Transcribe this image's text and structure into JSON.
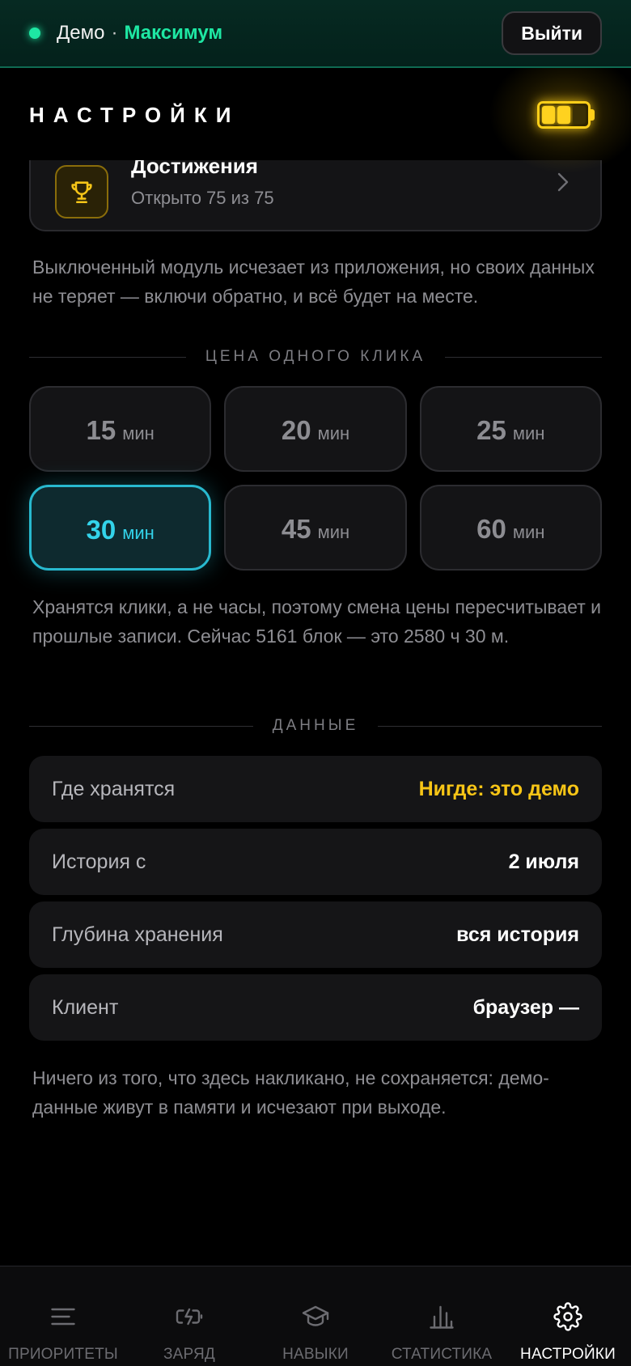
{
  "topbar": {
    "mode": "Демо",
    "separator": "·",
    "plan": "Максимум",
    "logout_label": "Выйти"
  },
  "header": {
    "title": "НАСТРОЙКИ",
    "battery": {
      "icon": "battery-icon",
      "cells_filled": 2,
      "cells_total": 3,
      "color": "#ffcf1a"
    }
  },
  "modules": {
    "achievements": {
      "icon": "trophy-icon",
      "title": "Достижения",
      "subtitle": "Открыто 75 из 75"
    },
    "note": "Выключенный модуль исчезает из приложения, но своих данных не теряет — включи обратно, и всё будет на месте."
  },
  "click_price": {
    "section_title": "ЦЕНА ОДНОГО КЛИКА",
    "unit": "мин",
    "options": [
      {
        "value": "15",
        "selected": false
      },
      {
        "value": "20",
        "selected": false
      },
      {
        "value": "25",
        "selected": false
      },
      {
        "value": "30",
        "selected": true
      },
      {
        "value": "45",
        "selected": false
      },
      {
        "value": "60",
        "selected": false
      }
    ],
    "note": "Хранятся клики, а не часы, поэтому смена цены пересчитывает и прошлые записи. Сейчас 5161 блок — это 2580 ч 30 м."
  },
  "data_section": {
    "section_title": "ДАННЫЕ",
    "rows": [
      {
        "key": "Где хранятся",
        "value": "Нигде: это демо"
      },
      {
        "key": "История с",
        "value": "2 июля"
      },
      {
        "key": "Глубина хранения",
        "value": "вся история"
      },
      {
        "key": "Клиент",
        "value": "браузер —"
      }
    ],
    "note": "Ничего из того, что здесь накликано, не сохраняется: демо-данные живут в памяти и исчезают при выходе."
  },
  "nav": {
    "items": [
      {
        "label": "ПРИОРИТЕТЫ",
        "icon": "list-icon"
      },
      {
        "label": "ЗАРЯД",
        "icon": "charge-icon"
      },
      {
        "label": "НАВЫКИ",
        "icon": "graduation-cap-icon"
      },
      {
        "label": "СТАТИСТИКА",
        "icon": "bar-chart-icon"
      },
      {
        "label": "НАСТРОЙКИ",
        "icon": "gear-icon",
        "active": true
      }
    ]
  },
  "colors": {
    "accent_green": "#1ee7a3",
    "accent_cyan": "#33d3ea",
    "accent_yellow": "#f7c516"
  }
}
